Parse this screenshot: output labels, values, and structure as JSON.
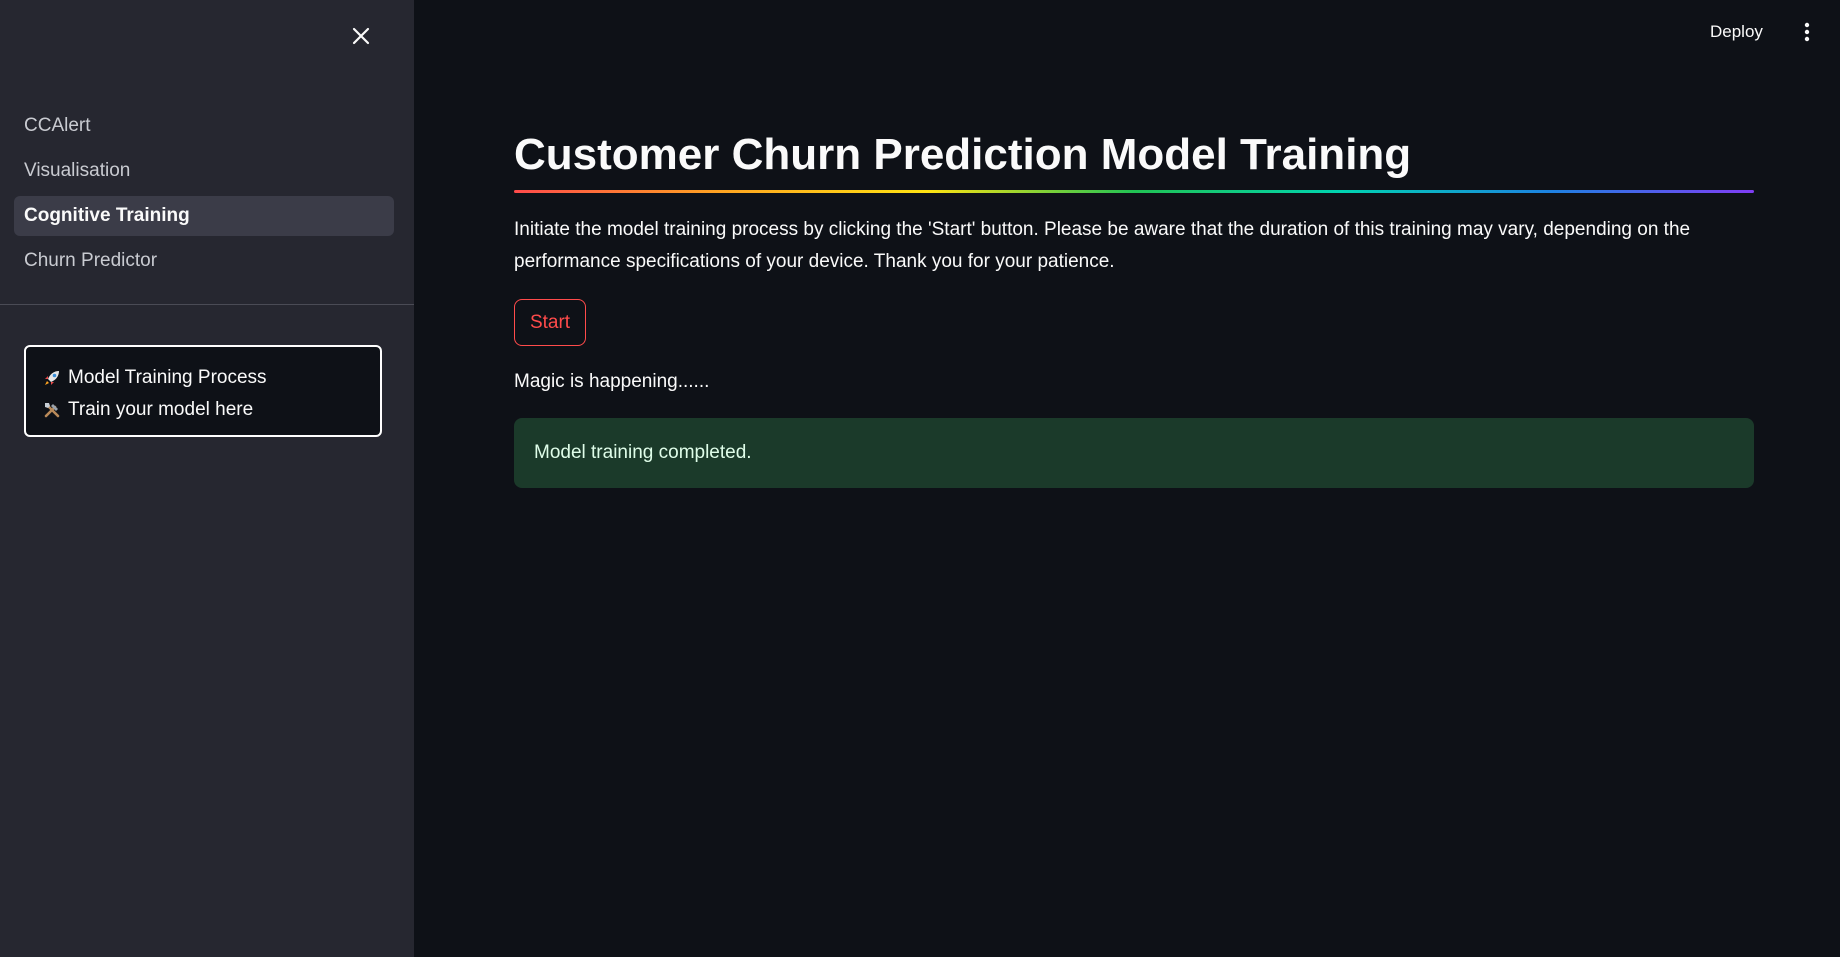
{
  "sidebar": {
    "close_icon": "close-icon",
    "nav_items": [
      {
        "label": "CCAlert",
        "active": false
      },
      {
        "label": "Visualisation",
        "active": false
      },
      {
        "label": "Cognitive Training",
        "active": true
      },
      {
        "label": "Churn Predictor",
        "active": false
      }
    ],
    "info_box": {
      "lines": [
        {
          "icon": "rocket-icon",
          "text": "Model Training Process"
        },
        {
          "icon": "tools-icon",
          "text": "Train your model here"
        }
      ]
    }
  },
  "header": {
    "deploy_label": "Deploy",
    "menu_icon": "kebab-menu-icon"
  },
  "main": {
    "title": "Customer Churn Prediction Model Training",
    "description": "Initiate the model training process by clicking the 'Start' button. Please be aware that the duration of this training may vary, depending on the performance specifications of your device. Thank you for your patience.",
    "start_label": "Start",
    "status_text": "Magic is happening......",
    "success_message": "Model training completed."
  },
  "colors": {
    "background": "#0e1117",
    "sidebar": "#262730",
    "accent": "#ff4b4b",
    "success_bg": "#1b3a2a"
  }
}
